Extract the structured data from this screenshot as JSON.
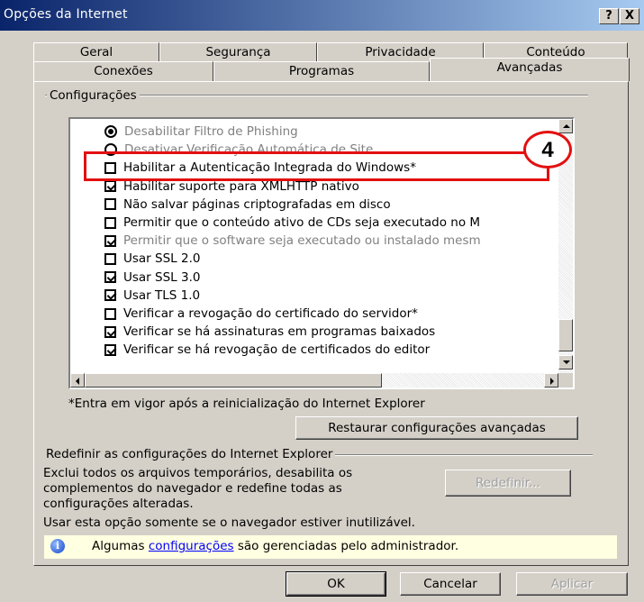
{
  "window": {
    "title": "Opções da Internet",
    "help_label": "?",
    "close_label": "X"
  },
  "tabs": {
    "row1": [
      "Geral",
      "Segurança",
      "Privacidade",
      "Conteúdo"
    ],
    "row2": [
      "Conexões",
      "Programas",
      "Avançadas"
    ],
    "active": "Avançadas"
  },
  "settings": {
    "group_label": "Configurações",
    "items": [
      {
        "type": "radio",
        "checked": true,
        "disabled": true,
        "label": "Desabilitar Filtro de Phishing"
      },
      {
        "type": "radio",
        "checked": false,
        "disabled": true,
        "label": "Desativar Verificação Automática de Site"
      },
      {
        "type": "checkbox",
        "checked": false,
        "disabled": false,
        "label": "Habilitar a Autenticação Integrada do Windows*"
      },
      {
        "type": "checkbox",
        "checked": true,
        "disabled": false,
        "label": "Habilitar suporte para XMLHTTP nativo"
      },
      {
        "type": "checkbox",
        "checked": false,
        "disabled": false,
        "label": "Não salvar páginas criptografadas em disco"
      },
      {
        "type": "checkbox",
        "checked": false,
        "disabled": false,
        "label": "Permitir que o conteúdo ativo de CDs seja executado no M"
      },
      {
        "type": "checkbox",
        "checked": true,
        "disabled": true,
        "label": "Permitir que o software seja executado ou instalado mesm"
      },
      {
        "type": "checkbox",
        "checked": false,
        "disabled": false,
        "label": "Usar SSL 2.0"
      },
      {
        "type": "checkbox",
        "checked": true,
        "disabled": false,
        "label": "Usar SSL 3.0"
      },
      {
        "type": "checkbox",
        "checked": true,
        "disabled": false,
        "label": "Usar TLS 1.0"
      },
      {
        "type": "checkbox",
        "checked": false,
        "disabled": false,
        "label": "Verificar a revogação do certificado do servidor*"
      },
      {
        "type": "checkbox",
        "checked": true,
        "disabled": false,
        "label": "Verificar se há assinaturas em programas baixados"
      },
      {
        "type": "checkbox",
        "checked": true,
        "disabled": false,
        "label": "Verificar se há revogação de certificados do editor"
      }
    ],
    "footnote": "*Entra em vigor após a reinicialização do Internet Explorer",
    "restore_button": "Restaurar configurações avançadas"
  },
  "reset": {
    "group_label": "Redefinir as configurações do Internet Explorer",
    "description_lines": [
      "Exclui todos os arquivos temporários, desabilita os",
      "complementos do navegador e redefine todas as",
      "configurações alteradas."
    ],
    "button": "Redefinir...",
    "note": "Usar esta opção somente se o navegador estiver inutilizável."
  },
  "info": {
    "prefix": "Algumas ",
    "link": "configurações",
    "suffix": " são gerenciadas pelo administrador."
  },
  "buttons": {
    "ok": "OK",
    "cancel": "Cancelar",
    "apply": "Aplicar"
  },
  "annotation": {
    "callout_number": "4",
    "highlight_color": "#e31010"
  }
}
